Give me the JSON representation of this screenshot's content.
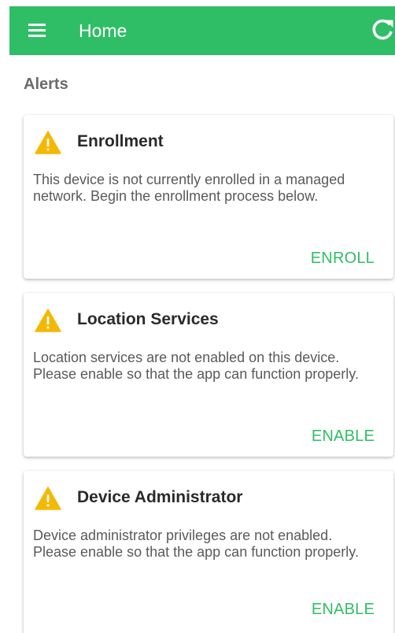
{
  "header": {
    "menu_icon": "menu-icon",
    "title": "Home",
    "refresh_icon": "refresh-icon",
    "color": "#2fbe66"
  },
  "alerts": {
    "section_title": "Alerts",
    "items": [
      {
        "icon": "warning-icon",
        "title": "Enrollment",
        "body": "This device is not currently enrolled in a managed network. Begin the enrollment process below.",
        "action": "ENROLL"
      },
      {
        "icon": "warning-icon",
        "title": "Location Services",
        "body": "Location services are not enabled on this device. Please enable so that the app can function properly.",
        "action": "ENABLE"
      },
      {
        "icon": "warning-icon",
        "title": "Device Administrator",
        "body": "Device administrator privileges are not enabled. Please enable so that the app can function properly.",
        "action": "ENABLE"
      }
    ]
  },
  "colors": {
    "accent": "#2fbe66",
    "warning": "#f5b800"
  }
}
